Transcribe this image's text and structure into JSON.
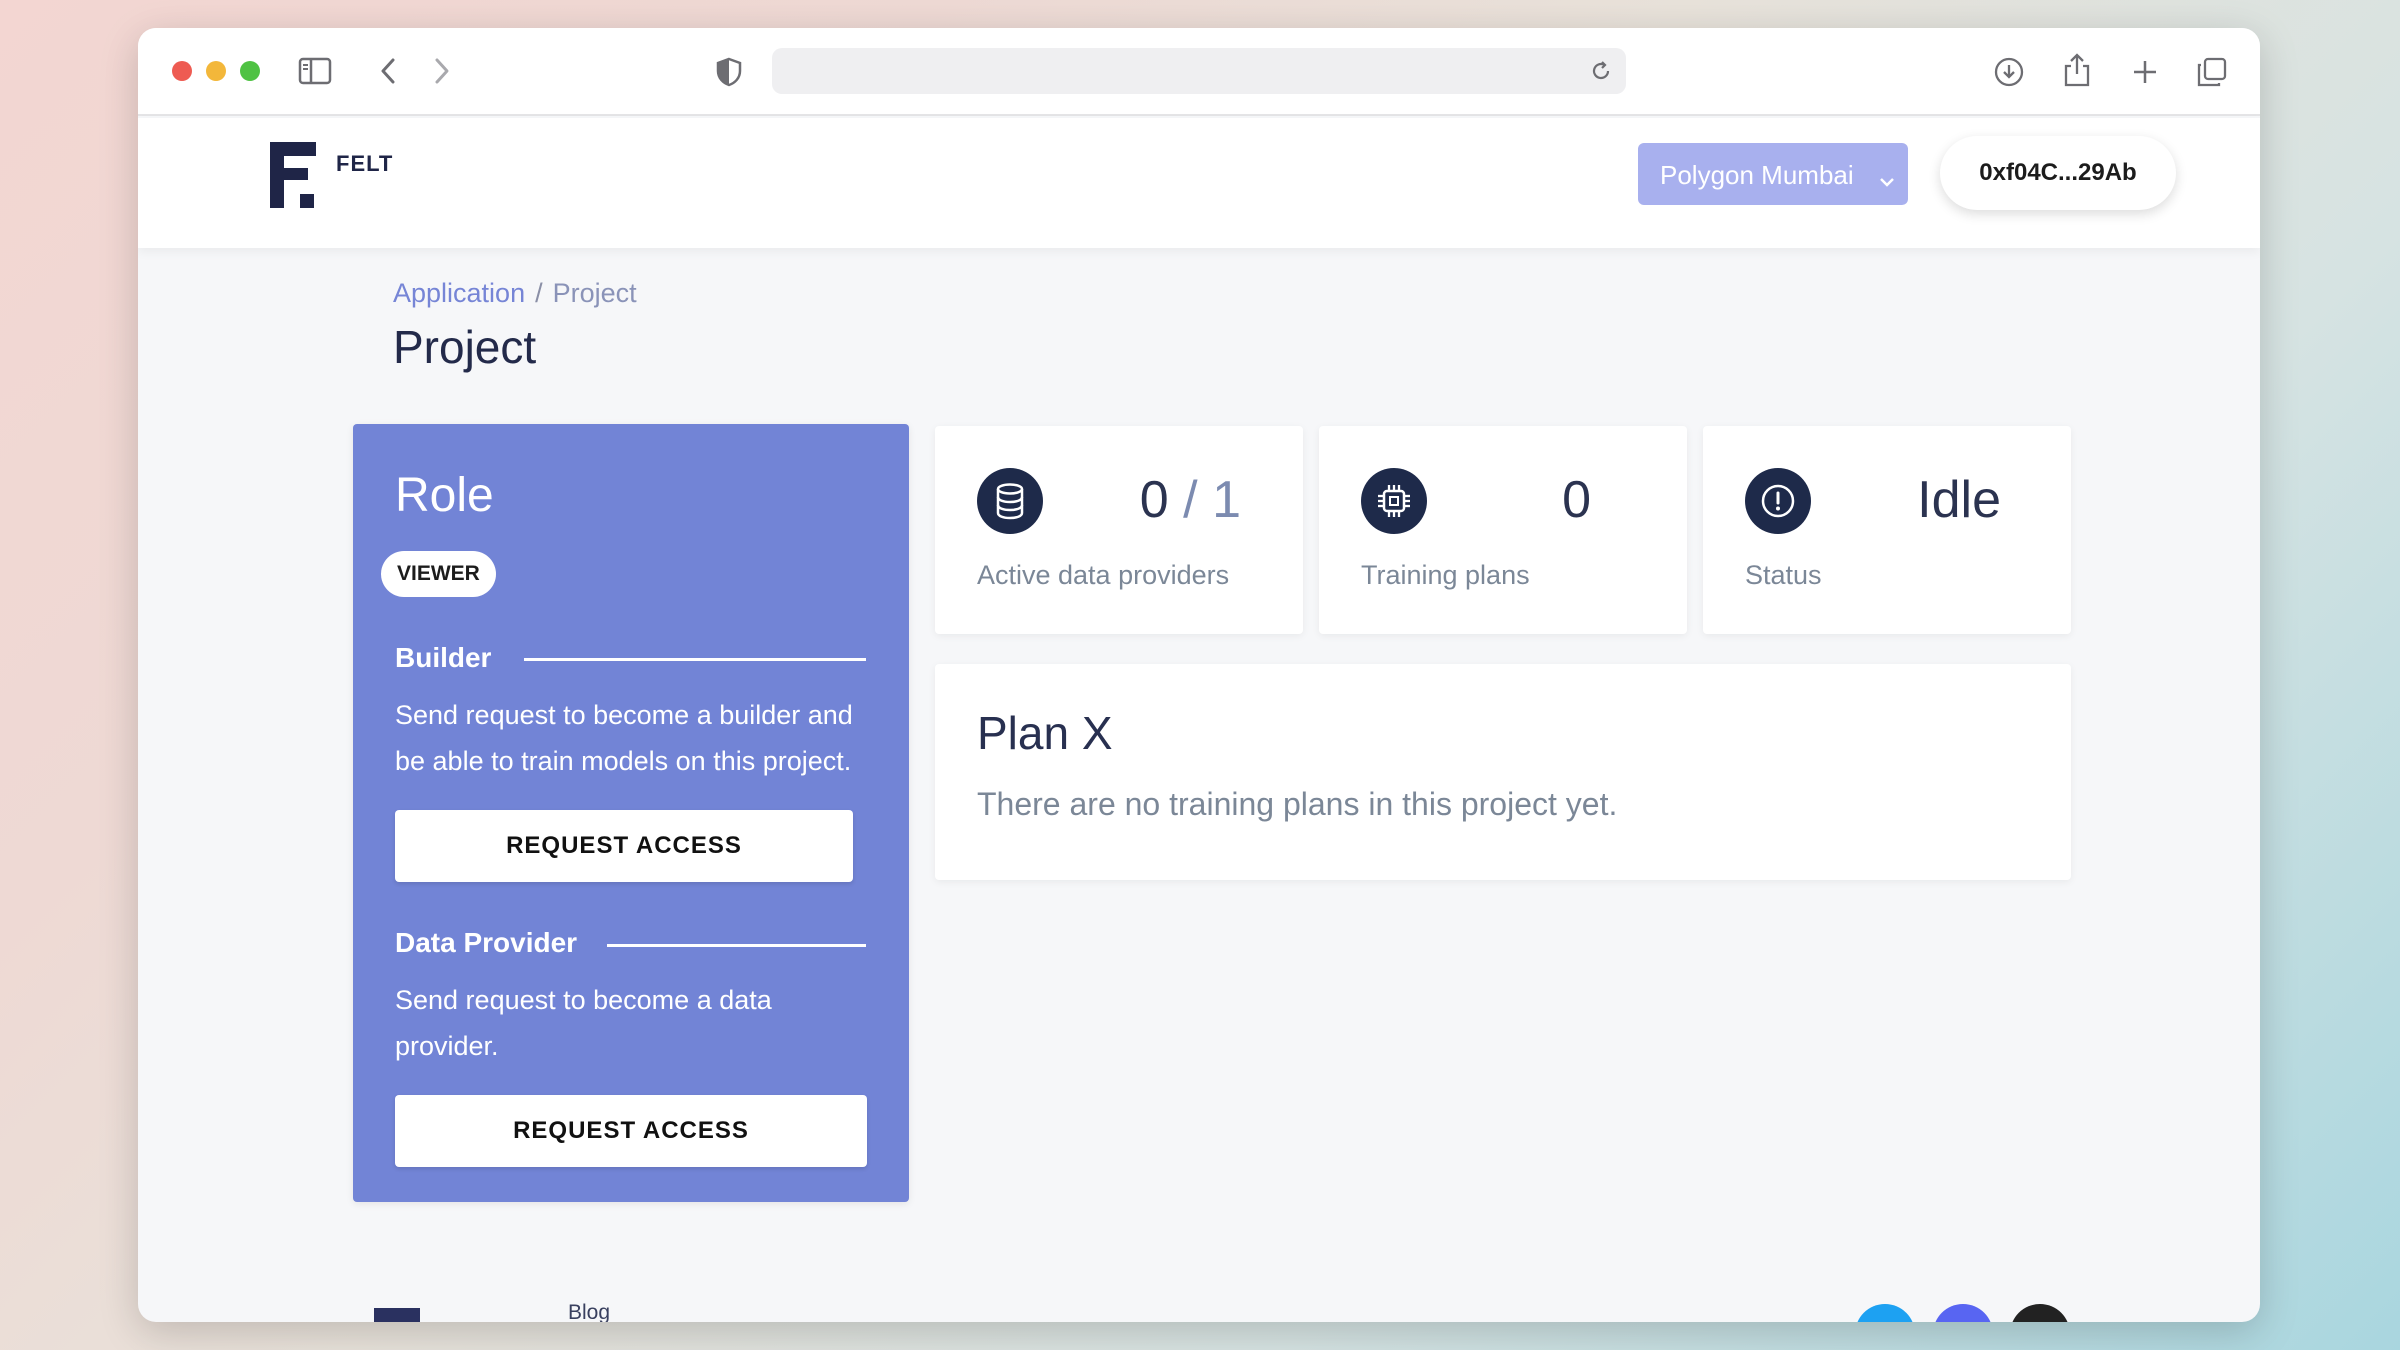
{
  "browser": {
    "url": ""
  },
  "header": {
    "logo_text": "FELT",
    "network": "Polygon Mumbai",
    "wallet": "0xf04C...29Ab"
  },
  "breadcrumb": {
    "items": [
      "Application",
      "Project"
    ],
    "separator": "/"
  },
  "page_title": "Project",
  "role_card": {
    "title": "Role",
    "badge": "VIEWER",
    "sections": [
      {
        "heading": "Builder",
        "description": "Send request to become a builder and be able to train models on this project.",
        "button": "REQUEST ACCESS"
      },
      {
        "heading": "Data Provider",
        "description": "Send request to become a data provider.",
        "button": "REQUEST ACCESS"
      }
    ]
  },
  "stats": [
    {
      "icon": "database-icon",
      "value": "0",
      "value_sep": "/",
      "value_total": "1",
      "label": "Active data providers"
    },
    {
      "icon": "chip-icon",
      "value": "0",
      "label": "Training plans"
    },
    {
      "icon": "alert-circle-icon",
      "value": "Idle",
      "label": "Status"
    }
  ],
  "plan": {
    "title": "Plan X",
    "empty_message": "There are no training plans in this project yet."
  },
  "footer": {
    "link_blog": "Blog"
  },
  "colors": {
    "role_card_bg": "#7284d6",
    "network_select_bg": "#a8b0ee",
    "icon_circle": "#1e2a4a",
    "social_twitter": "#1da1f2",
    "social_discord": "#5865f2",
    "social_github": "#222222"
  }
}
